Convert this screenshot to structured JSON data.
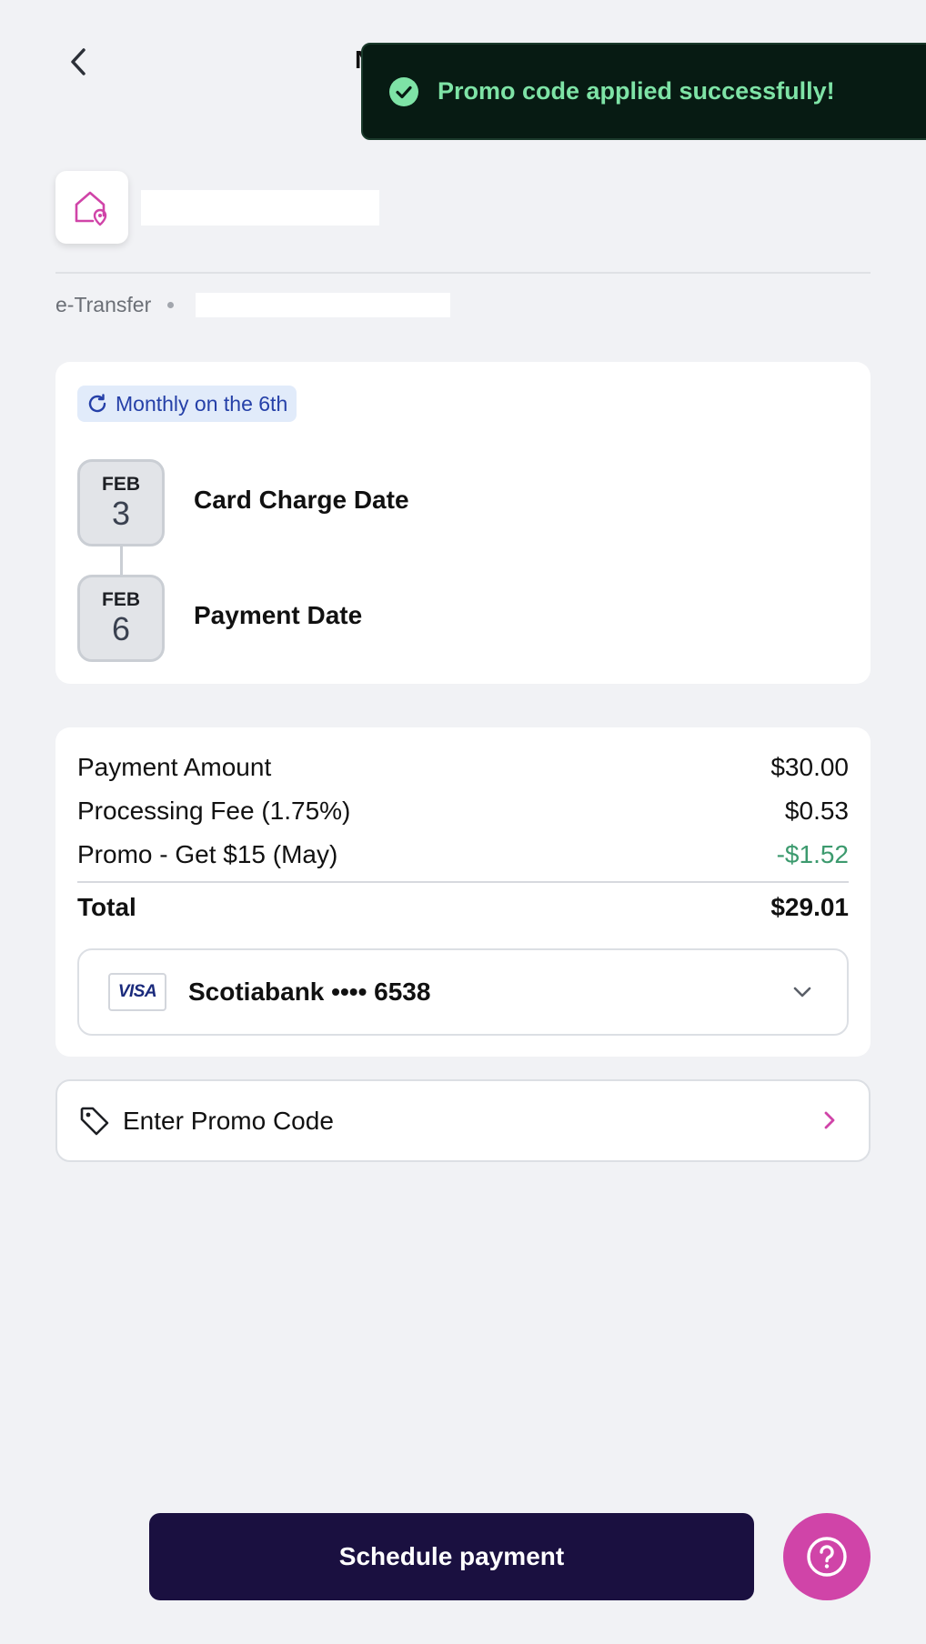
{
  "header": {
    "title_partial": "N",
    "back_icon": "chevron-left-icon"
  },
  "toast": {
    "message": "Promo code applied successfully!",
    "icon": "check-circle-icon",
    "text_color": "#7ee3a6",
    "background": "#071b13"
  },
  "payee": {
    "icon": "home-location-icon",
    "icon_color": "#d044a8",
    "method": "e-Transfer"
  },
  "schedule": {
    "recurrence": "Monthly on the 6th",
    "recurrence_icon": "refresh-icon",
    "dates": [
      {
        "month": "FEB",
        "day": "3",
        "label": "Card Charge Date"
      },
      {
        "month": "FEB",
        "day": "6",
        "label": "Payment Date"
      }
    ]
  },
  "summary": {
    "rows": [
      {
        "label": "Payment Amount",
        "value": "$30.00"
      },
      {
        "label": "Processing Fee (1.75%)",
        "value": "$0.53"
      },
      {
        "label": "Promo - Get $15 (May)",
        "value": "-$1.52"
      }
    ],
    "total_label": "Total",
    "total_value": "$29.01",
    "discount_color": "#3c9a6e"
  },
  "payment_card": {
    "brand": "VISA",
    "label": "Scotiabank •••• 6538",
    "dropdown_icon": "chevron-down-icon"
  },
  "promo": {
    "label": "Enter Promo Code",
    "icon": "tag-icon",
    "chevron_icon": "chevron-right-icon"
  },
  "actions": {
    "schedule_label": "Schedule payment",
    "button_color": "#1a1040",
    "help_icon": "help-circle-icon",
    "help_color": "#d044a8"
  }
}
